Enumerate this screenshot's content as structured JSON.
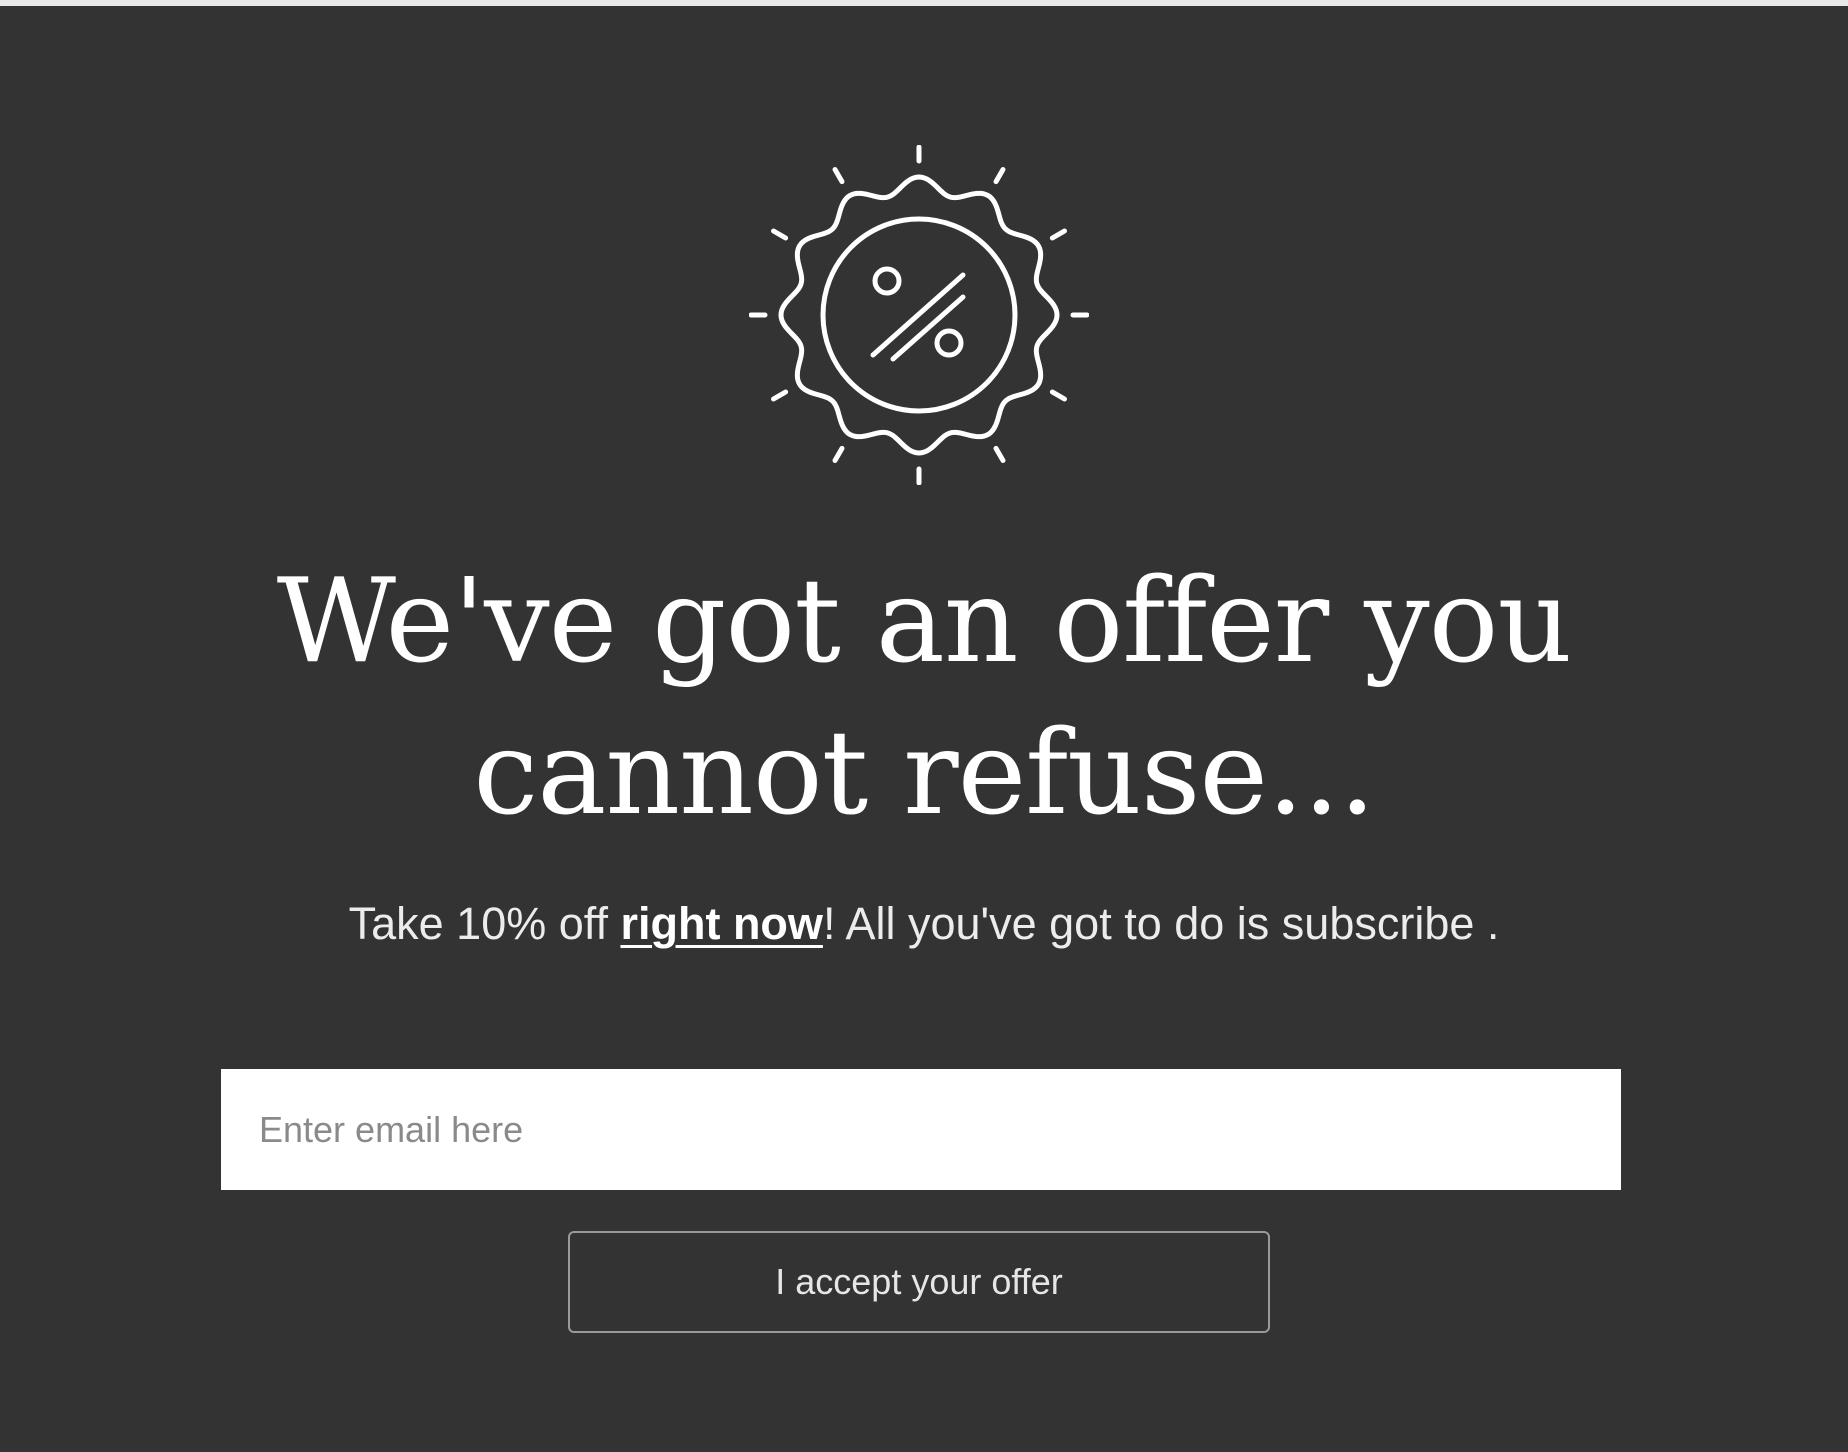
{
  "popup": {
    "badge_icon": "discount-percent-badge-icon",
    "headline_line1": "We've got an offer you",
    "headline_line2": "cannot refuse...",
    "subtext_before": "Take 10% off ",
    "subtext_link": "right now",
    "subtext_after": "! All you've got to do is subscribe .",
    "email_placeholder": "Enter email here",
    "email_value": "",
    "button_label": "I accept your offer"
  },
  "colors": {
    "background": "#333333",
    "text": "#ffffff",
    "input_background": "#ffffff",
    "button_border": "#9a9a9a"
  }
}
